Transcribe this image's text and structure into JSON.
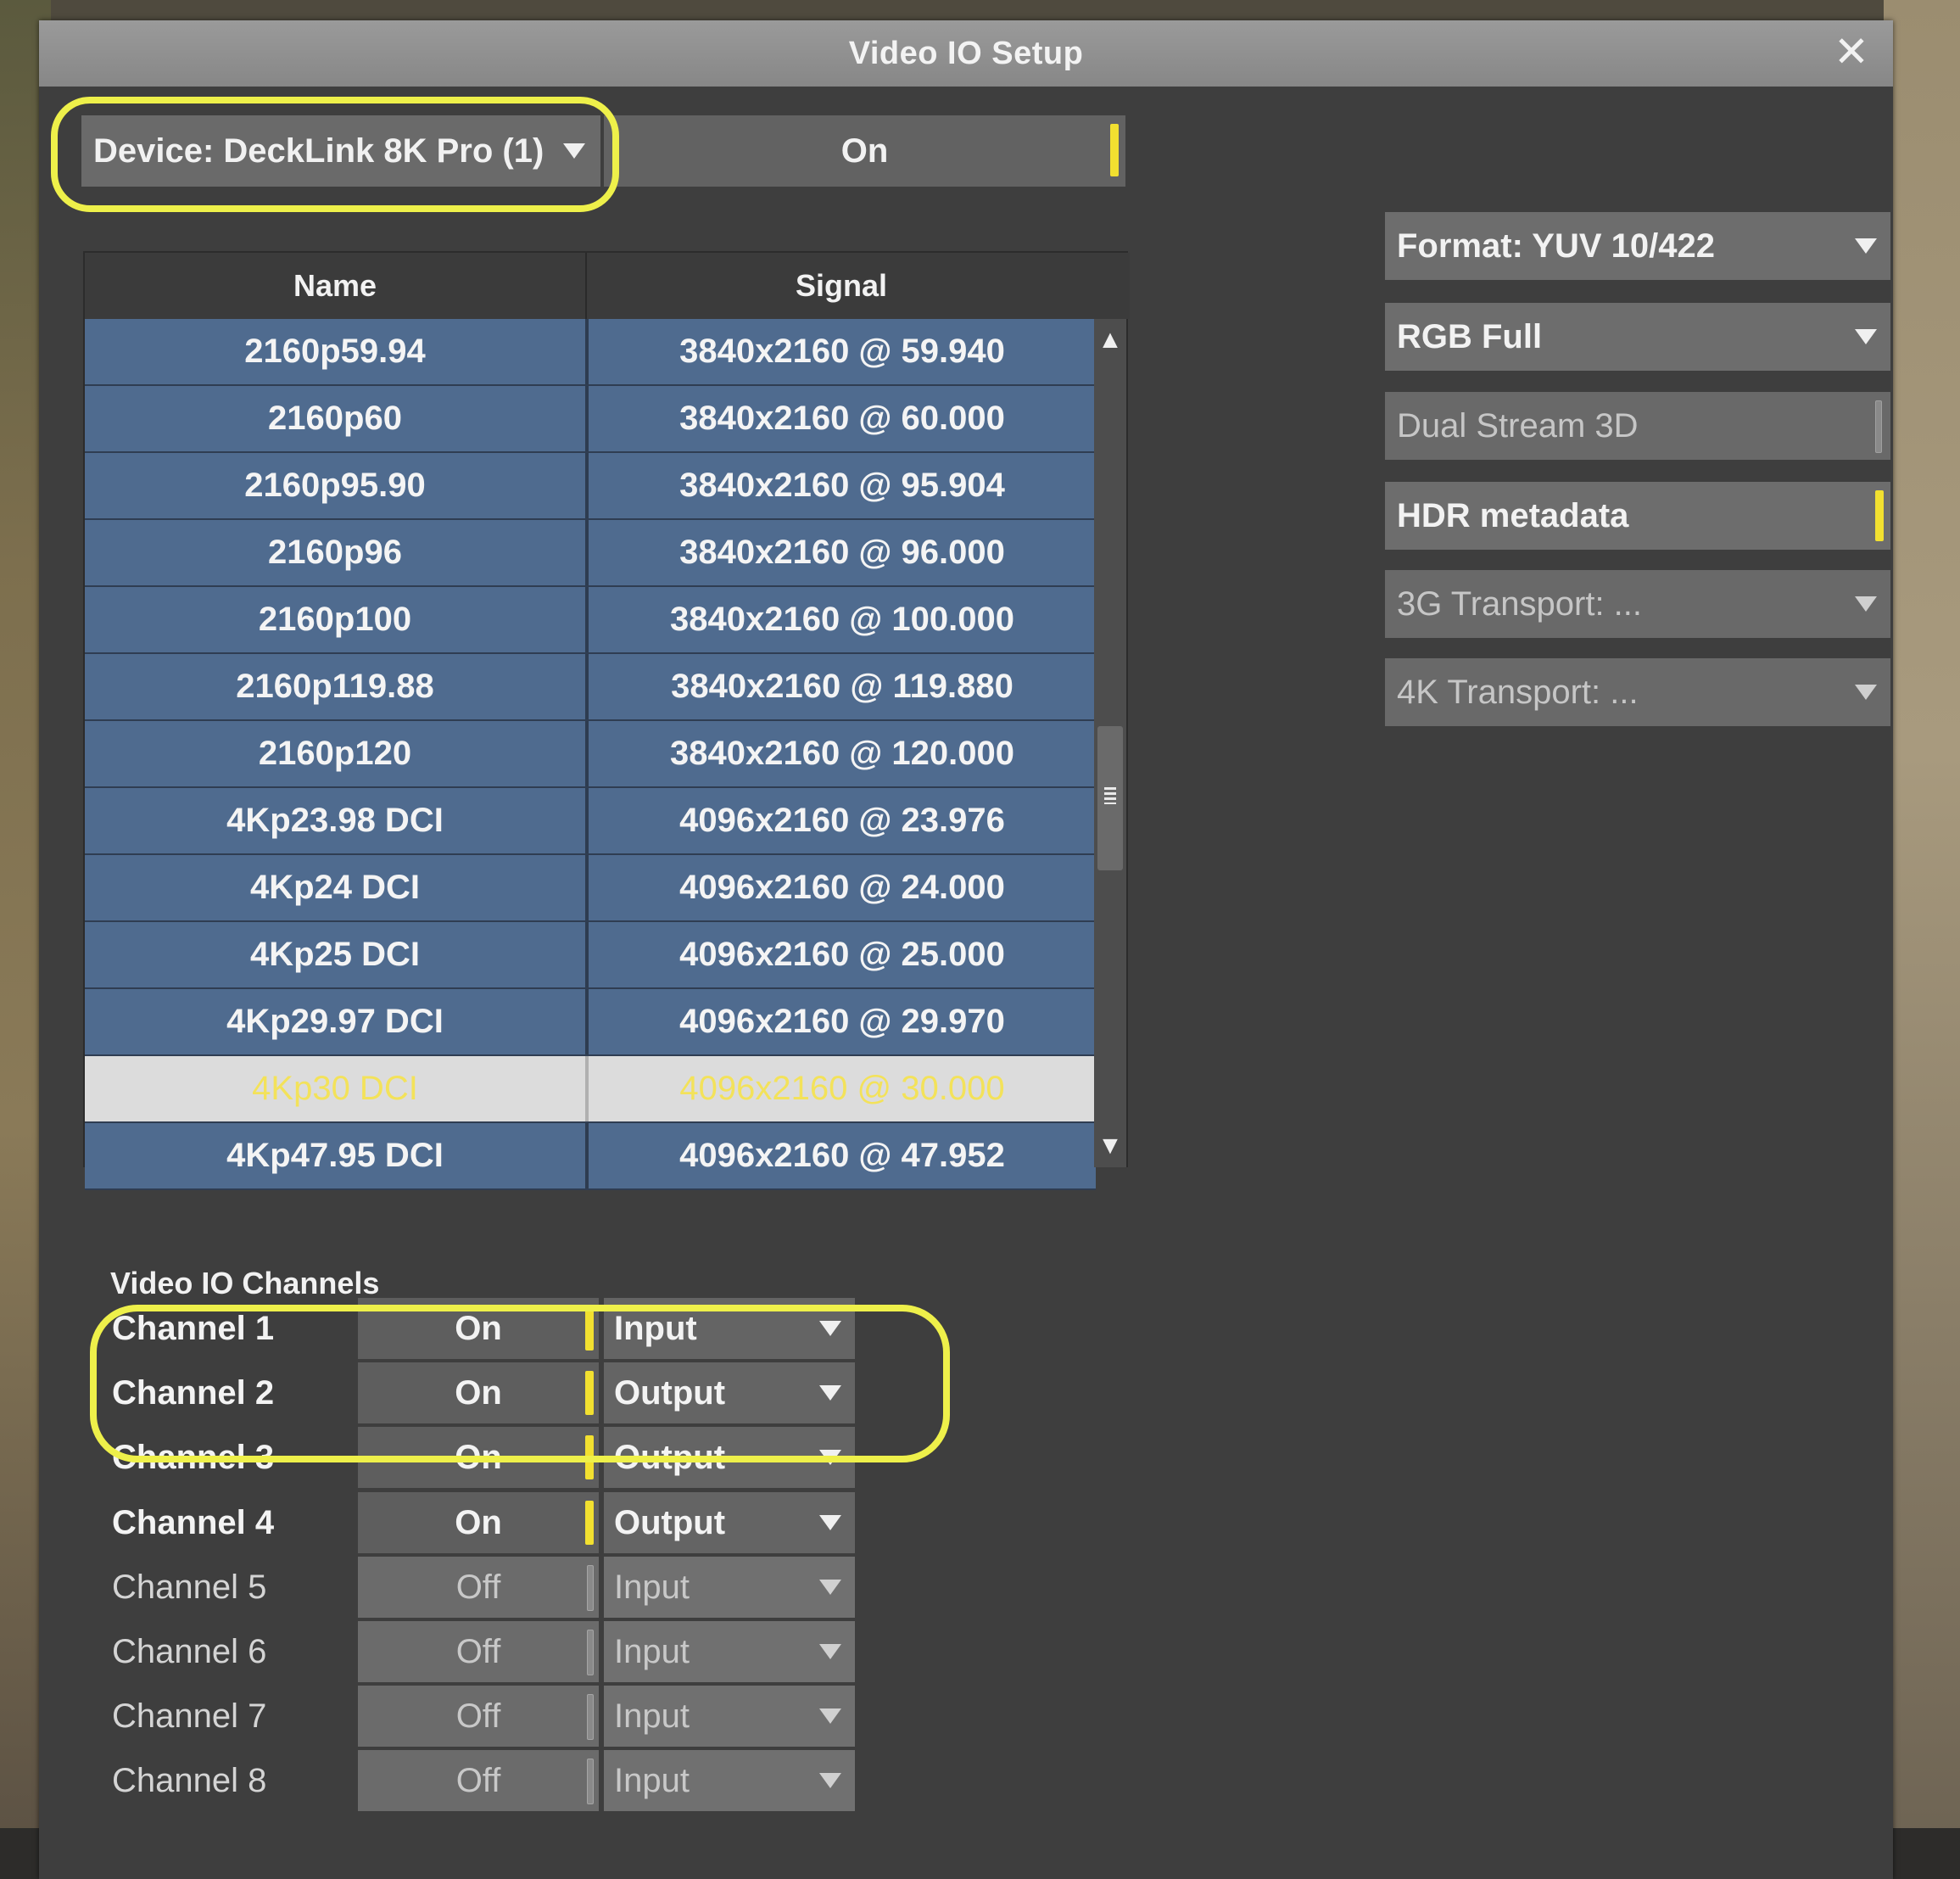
{
  "window": {
    "title": "Video IO Setup"
  },
  "device": {
    "label": "Device: DeckLink 8K Pro (1)",
    "state": "On"
  },
  "table": {
    "headers": {
      "name": "Name",
      "signal": "Signal"
    },
    "rows": [
      {
        "name": "2160p59.94",
        "signal": "3840x2160 @ 59.940"
      },
      {
        "name": "2160p60",
        "signal": "3840x2160 @ 60.000"
      },
      {
        "name": "2160p95.90",
        "signal": "3840x2160 @ 95.904"
      },
      {
        "name": "2160p96",
        "signal": "3840x2160 @ 96.000"
      },
      {
        "name": "2160p100",
        "signal": "3840x2160 @ 100.000"
      },
      {
        "name": "2160p119.88",
        "signal": "3840x2160 @ 119.880"
      },
      {
        "name": "2160p120",
        "signal": "3840x2160 @ 120.000"
      },
      {
        "name": "4Kp23.98 DCI",
        "signal": "4096x2160 @ 23.976"
      },
      {
        "name": "4Kp24 DCI",
        "signal": "4096x2160 @ 24.000"
      },
      {
        "name": "4Kp25 DCI",
        "signal": "4096x2160 @ 25.000"
      },
      {
        "name": "4Kp29.97 DCI",
        "signal": "4096x2160 @ 29.970"
      },
      {
        "name": "4Kp30 DCI",
        "signal": "4096x2160 @ 30.000",
        "selected": true
      },
      {
        "name": "4Kp47.95 DCI",
        "signal": "4096x2160 @ 47.952"
      }
    ]
  },
  "right_panel": {
    "format": "Format: YUV 10/422",
    "color_range": "RGB Full",
    "dual_stream": "Dual Stream 3D",
    "hdr": "HDR metadata",
    "transport_3g": "3G Transport: ...",
    "transport_4k": "4K Transport: ..."
  },
  "channels": {
    "section_label": "Video IO Channels",
    "items": [
      {
        "label": "Channel 1",
        "state": "On",
        "direction": "Input"
      },
      {
        "label": "Channel 2",
        "state": "On",
        "direction": "Output"
      },
      {
        "label": "Channel 3",
        "state": "On",
        "direction": "Output"
      },
      {
        "label": "Channel 4",
        "state": "On",
        "direction": "Output"
      },
      {
        "label": "Channel 5",
        "state": "Off",
        "direction": "Input"
      },
      {
        "label": "Channel 6",
        "state": "Off",
        "direction": "Input"
      },
      {
        "label": "Channel 7",
        "state": "Off",
        "direction": "Input"
      },
      {
        "label": "Channel 8",
        "state": "Off",
        "direction": "Input"
      }
    ]
  },
  "colors": {
    "accent_yellow": "#f2e030",
    "highlight_outline": "#eef04a",
    "row_blue": "#4f6b8f",
    "selected_row": "#dcdcdc",
    "selected_text": "#f3e25a"
  },
  "icons": {
    "close": "close-icon",
    "dropdown": "chevron-down-icon",
    "scroll_up": "arrow-up-icon",
    "scroll_down": "arrow-down-icon"
  }
}
